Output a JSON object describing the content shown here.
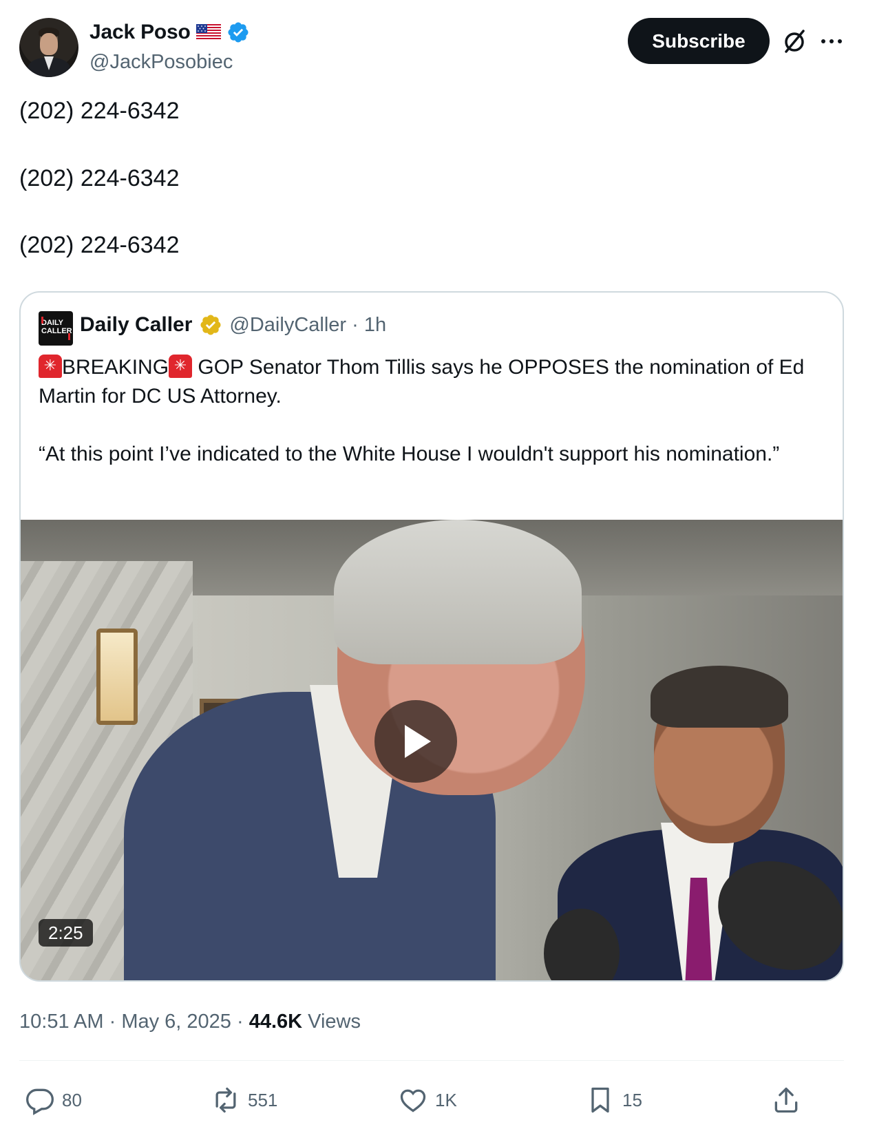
{
  "author": {
    "display_name": "Jack Poso",
    "handle": "@JackPosobiec",
    "flag_icon": "us-flag-icon",
    "verified_icon": "verified-badge-icon",
    "verified_color": "#1d9bf0"
  },
  "header": {
    "subscribe_label": "Subscribe"
  },
  "tweet": {
    "lines": [
      "(202) 224-6342",
      "(202) 224-6342",
      "(202) 224-6342"
    ]
  },
  "quote": {
    "logo_text": "DAILY CALLER",
    "display_name": "Daily Caller",
    "handle_time": "@DailyCaller · 1h",
    "gold_badge_color": "#e2b719",
    "breaking_label": "BREAKING",
    "text_line1_rest": " GOP Senator Thom Tillis says he OPPOSES the nomination of Ed Martin for DC US Attorney.",
    "text_para2": "“At this point I’ve indicated to the White House I wouldn't support his nomination.”",
    "video_duration": "2:25"
  },
  "meta": {
    "time": "10:51 AM",
    "date": "May 6, 2025",
    "views_count": "44.6K",
    "views_label": "Views"
  },
  "actions": {
    "replies": "80",
    "reposts": "551",
    "likes": "1K",
    "bookmarks": "15"
  }
}
